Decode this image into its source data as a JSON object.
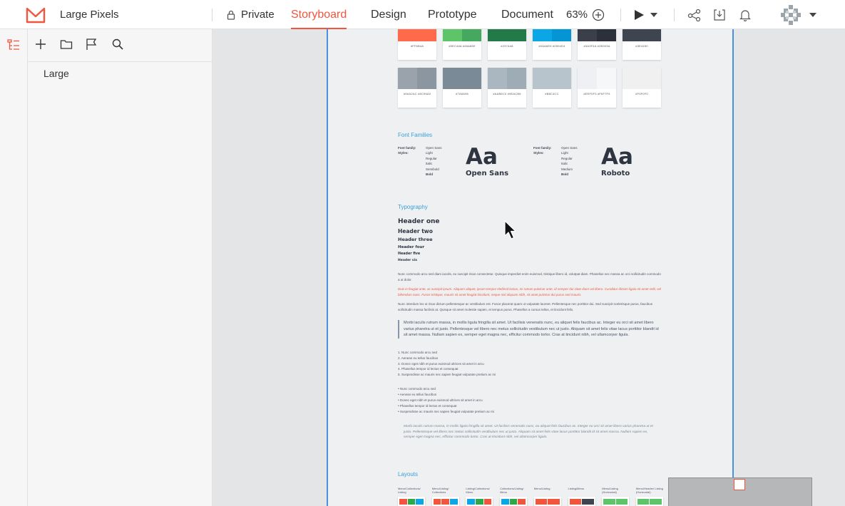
{
  "app": {
    "project_name": "Large Pixels",
    "privacy_label": "Private"
  },
  "tabs": [
    {
      "label": "Storyboard",
      "active": true
    },
    {
      "label": "Design",
      "active": false
    },
    {
      "label": "Prototype",
      "active": false
    },
    {
      "label": "Document",
      "active": false
    }
  ],
  "zoom": {
    "value": "63%"
  },
  "colors": {
    "accent": "#f2553d",
    "selection": "#4a8fe0"
  },
  "icons": [
    "logo-icon",
    "lock-icon",
    "zoom-in-icon",
    "play-icon",
    "chevron-down-icon",
    "share-icon",
    "download-icon",
    "bell-icon",
    "avatar",
    "layers-icon",
    "add-icon",
    "folder-icon",
    "flag-icon",
    "search-icon",
    "cursor-icon"
  ],
  "sidebar": {
    "pages": [
      {
        "label": "Large"
      }
    ]
  },
  "artboard": {
    "swatches": [
      {
        "colors": [
          "#ff6b4a"
        ],
        "labels": "#FF6B4A"
      },
      {
        "colors": [
          "#5ec46a",
          "#46a85e"
        ],
        "labels": "#5EC46A  #46A85E"
      },
      {
        "colors": [
          "#237a48"
        ],
        "labels": "#237A48"
      },
      {
        "colors": [
          "#0aa6e6",
          "#0594d4"
        ],
        "labels": "#0AA6E6  #0594D4"
      },
      {
        "colors": [
          "#3a3f4a",
          "#2b303a"
        ],
        "labels": "#3A3F4A  #2B303A"
      },
      {
        "colors": [
          "#3e4450"
        ],
        "labels": "#3E4450"
      },
      {
        "colors": [
          "#9aa2ac",
          "#8c96a0"
        ],
        "labels": "#9AA2AC  #8C96A0"
      },
      {
        "colors": [
          "#7a8a96"
        ],
        "labels": "#7A8A96"
      },
      {
        "colors": [
          "#aab6c0",
          "#9eacb6"
        ],
        "labels": "#AAB6C0  #9EACB6"
      },
      {
        "colors": [
          "#b8c4cc"
        ],
        "labels": "#B8C4CC"
      },
      {
        "colors": [
          "#eef0f3",
          "#f6f7f9"
        ],
        "labels": "#EEF0F3  #F6F7F9"
      },
      {
        "colors": [
          "#f0f0f0"
        ],
        "labels": "#F0F0F0"
      }
    ],
    "font_families_title": "Font Families",
    "font_blocks": [
      {
        "family_label": "Font family:",
        "styles_label": "Styles:",
        "family": "Open Sans",
        "styles": [
          "Light",
          "Regular",
          "Italic",
          "Semibold",
          "Bold"
        ],
        "sample": "Aa",
        "name": "Open Sans"
      },
      {
        "family_label": "Font family:",
        "styles_label": "Styles:",
        "family": "Open Sans",
        "styles": [
          "Light",
          "Regular",
          "Italic",
          "Medium",
          "Bold"
        ],
        "sample": "Aa",
        "name": "Roboto"
      }
    ],
    "typography_title": "Typography",
    "headers": [
      "Header one",
      "Header two",
      "Header three",
      "Header four",
      "Header five",
      "Header six"
    ],
    "para1": "Nunc commodo arcu sed diam iaculis, eu suscipit risus consectetur. Quisque imperdiet enim euismod, tristique libero id, volutpat diam. Phasellus nec massa ac orci sollicitudin commodo a ut dolor.",
    "para2": "Duis in feugiat ante, ac suscipit ipsum. Aliquam aliquet, ipsum tempor eleifend luctus, mi rutrum pulvinar ante, id semper dui vitae diam vel libero. Curabitur dictum ligula sit amet velit, vel bibendum nunc. Fusce tristique, mauris sit amet feugiat tincidunt, neque nisl aliquam nibh, sit amet pulvinar dui purus sed mauris.",
    "para3": "Nunc interdum leo ut risus dictum pellentesque ac vestibulum est. Fusce placerat quam ut vulputate laoreet. Pellentesque nec porttitor dui. Sed suscipit scelerisque purus, faucibus sollicitudin massa facilisis at. Quisque sit amet molestie sapien, et tempus purus. Phasellus a cursus tellus, et tincidunt felis.",
    "quote": "Morbi iaculis rutrum massa, in mollis ligula fringilla sit amet. Ut facilisis venenatis nunc, eu aliquet felis faucibus ac. Integer eu orci sit amet libero varius pharetra ut et justo. Pellentesque vel libero nec metus sollicitudin vestibulum nec ut justo. Aliquam sit amet felis vitae lacus porttitor blandit id sit amet massa. Nullam sapien ex, semper eget magna nec, efficitur commodo tortor. Cras at tincidunt nibh, vel ullamcorper ligula.",
    "ordered_list": [
      "1. Nunc commodo arcu sed",
      "2. Aenean eu tellus faucibus",
      "3. Donec eget nibh et purus euismod ultrices sit amet in arcu",
      "4. Phasellus tempor id lectus et consequat",
      "5. Suspendisse ac mauris nec sapien feugiat vulputate pretium ac mi"
    ],
    "bullet_list": [
      "•  Nunc commodo arcu sed",
      "•  Aenean eu tellus faucibus",
      "•  Donec eget nibh et purus euismod ultrices sit amet in arcu",
      "•  Phasellus tempor id lectus et consequat",
      "•  Suspendisse ac mauris nec sapien feugiat vulputate pretium ac mi"
    ],
    "italic_quote": "Morbi iaculis rutrum massa, in mollis ligula fringilla sit amet. Ut facilisis venenatis nunc, eu aliquet felis faucibus ac. Integer eu orci sit amet libero varius pharetra ut et justo. Pellentesque vel libero nec metus sollicitudin vestibulum nec ut justo. Aliquam sit amet felis vitae lacus porttitor blandit id sit amet massa. Nullam sapien ex, semper eget magna nec, efficitur commodo tortor. Cras at tincidunt nibh, vel ullamcorper ligula.",
    "layouts_title": "Layouts",
    "layouts": [
      {
        "label": "Menu/Collections/ Listing",
        "colors": [
          "#f2553d",
          "#2aa84a",
          "#0aa6e6"
        ]
      },
      {
        "label": "Menu/Listing/ Collections",
        "colors": [
          "#f2553d",
          "#f2553d",
          "#0aa6e6"
        ]
      },
      {
        "label": "Listing/Collections/ Menu",
        "colors": [
          "#0aa6e6",
          "#2aa84a",
          "#f2553d"
        ]
      },
      {
        "label": "Collections/Listing/ Menu",
        "colors": [
          "#0aa6e6",
          "#2aa84a",
          "#f2553d"
        ]
      },
      {
        "label": "Menu/Listing",
        "colors": [
          "#f2553d",
          "#f2553d"
        ]
      },
      {
        "label": "Listing/Menu",
        "colors": [
          "#f2553d",
          "#3e4450"
        ]
      },
      {
        "label": "Menu/Listing (Horizontal)",
        "colors": [
          "#5ec46a",
          "#5ec46a"
        ]
      },
      {
        "label": "Menu/Header/ Listing (Horizontal)",
        "colors": [
          "#5ec46a",
          "#5ec46a"
        ]
      }
    ]
  }
}
